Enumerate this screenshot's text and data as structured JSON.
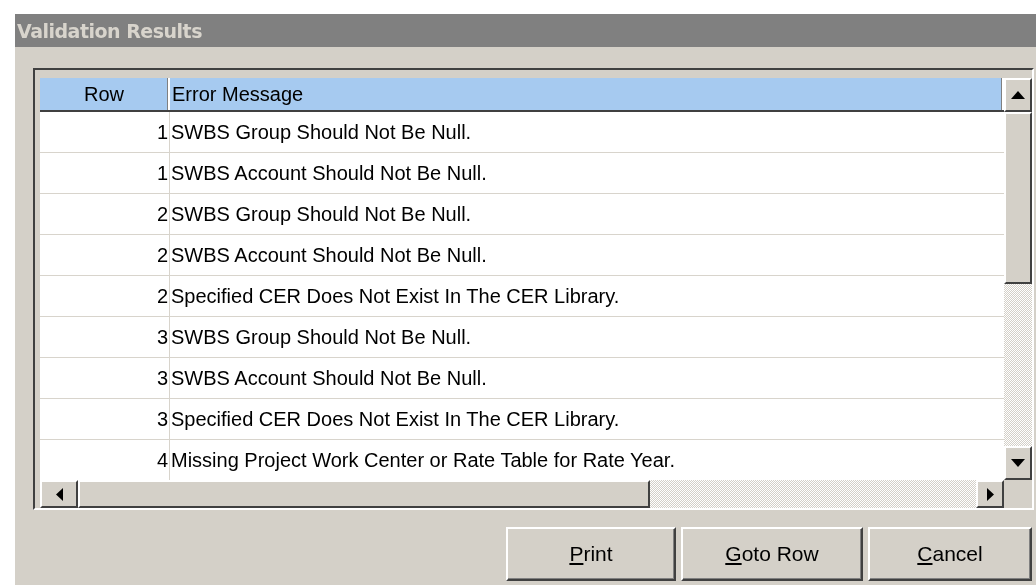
{
  "window": {
    "title": "Validation Results"
  },
  "table": {
    "columns": [
      "Row",
      "Error Message"
    ],
    "rows": [
      {
        "row": "1",
        "message": "SWBS Group Should Not Be Null."
      },
      {
        "row": "1",
        "message": "SWBS Account Should Not Be Null."
      },
      {
        "row": "2",
        "message": "SWBS Group Should Not Be Null."
      },
      {
        "row": "2",
        "message": "SWBS Account Should Not Be Null."
      },
      {
        "row": "2",
        "message": "Specified CER Does Not Exist In The CER Library."
      },
      {
        "row": "3",
        "message": "SWBS Group Should Not Be Null."
      },
      {
        "row": "3",
        "message": "SWBS Account Should Not Be Null."
      },
      {
        "row": "3",
        "message": "Specified CER Does Not Exist In The CER Library."
      },
      {
        "row": "4",
        "message": "Missing Project Work Center or Rate Table for Rate Year."
      }
    ]
  },
  "buttons": [
    "Print",
    "Goto Row",
    "Cancel"
  ]
}
